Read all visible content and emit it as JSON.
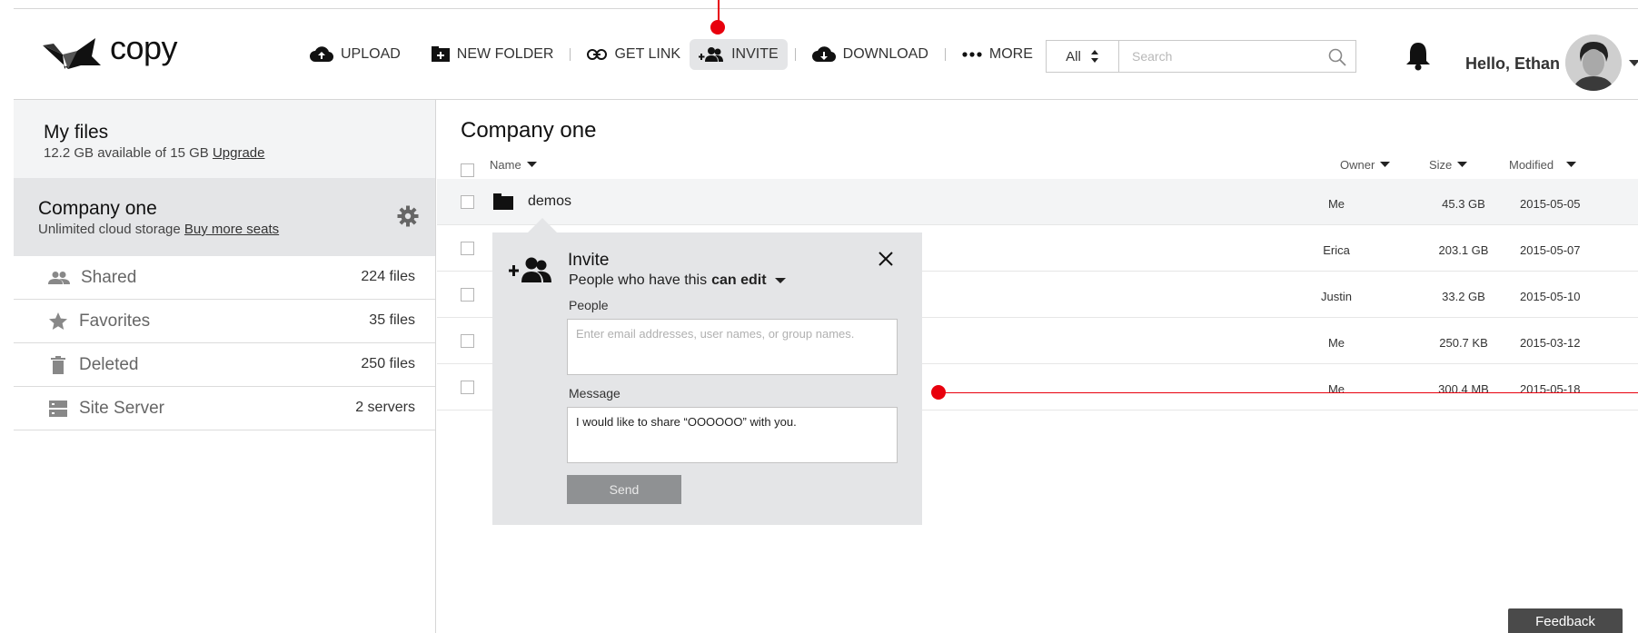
{
  "app": {
    "logo_text": "copy"
  },
  "toolbar": {
    "upload": "UPLOAD",
    "new_folder": "NEW FOLDER",
    "get_link": "GET LINK",
    "invite": "INVITE",
    "download": "DOWNLOAD",
    "more": "MORE"
  },
  "search": {
    "scope": "All",
    "placeholder": "Search"
  },
  "user": {
    "greeting": "Hello, Ethan"
  },
  "sidebar": {
    "my_files": {
      "title": "My files",
      "storage": "12.2 GB available of 15 GB",
      "upgrade": "Upgrade"
    },
    "company": {
      "title": "Company one",
      "storage": "Unlimited cloud storage",
      "buy": "Buy more seats"
    },
    "items": [
      {
        "label": "Shared",
        "count": "224 files",
        "icon": "people-icon"
      },
      {
        "label": "Favorites",
        "count": "35 files",
        "icon": "star-icon"
      },
      {
        "label": "Deleted",
        "count": "250 files",
        "icon": "trash-icon"
      },
      {
        "label": "Site Server",
        "count": "2 servers",
        "icon": "server-icon"
      }
    ]
  },
  "main": {
    "title": "Company one",
    "columns": {
      "name": "Name",
      "owner": "Owner",
      "size": "Size",
      "modified": "Modified"
    },
    "rows": [
      {
        "name": "demos",
        "owner": "Me",
        "size": "45.3 GB",
        "modified": "2015-05-05"
      },
      {
        "name": "",
        "owner": "Erica",
        "size": "203.1 GB",
        "modified": "2015-05-07"
      },
      {
        "name": "",
        "owner": "Justin",
        "size": "33.2 GB",
        "modified": "2015-05-10"
      },
      {
        "name": "",
        "owner": "Me",
        "size": "250.7 KB",
        "modified": "2015-03-12"
      },
      {
        "name": "",
        "owner": "Me",
        "size": "300.4 MB",
        "modified": "2015-05-18"
      }
    ]
  },
  "invite": {
    "title": "Invite",
    "permission_prefix": "People who have this",
    "permission": "can edit",
    "people_label": "People",
    "people_placeholder": "Enter email addresses, user names, or group names.",
    "message_label": "Message",
    "message_value": "I would like to share “OOOOOO” with you.",
    "send": "Send"
  },
  "feedback": "Feedback",
  "colors": {
    "accent_gray": "#e4e5e7",
    "annotation_red": "#e8000d",
    "send_button": "#8f9193"
  }
}
